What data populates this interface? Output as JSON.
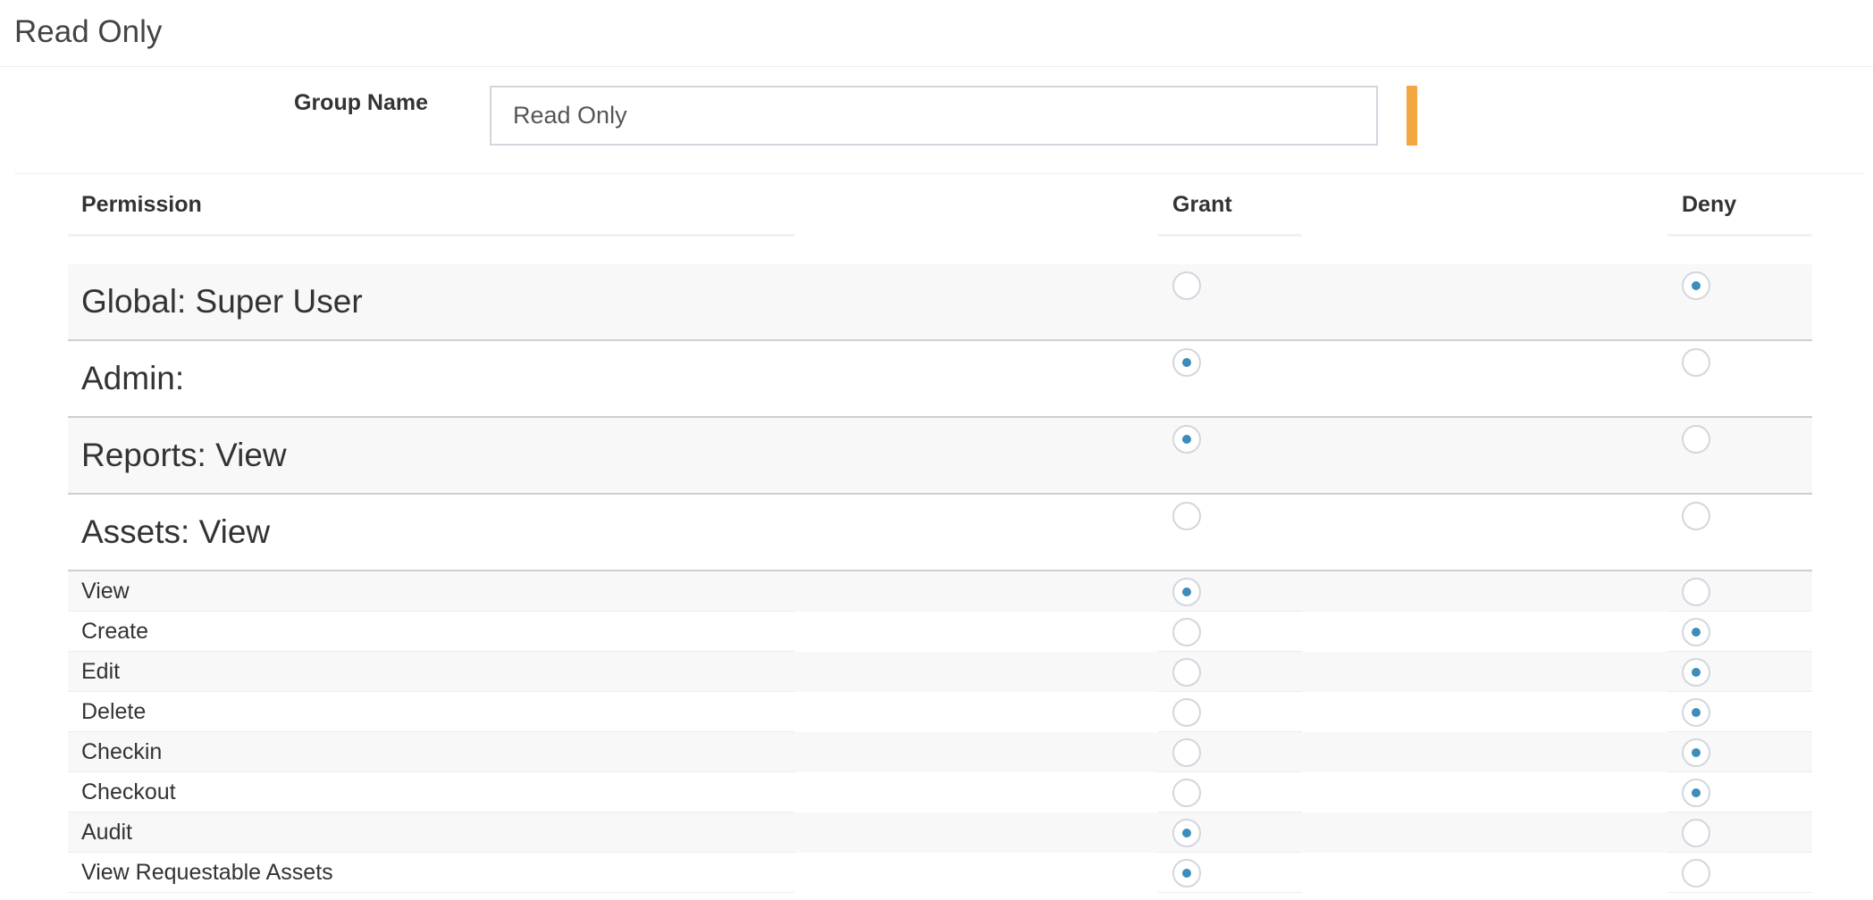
{
  "page": {
    "title": "Read Only"
  },
  "form": {
    "group_name_label": "Group Name",
    "group_name_value": "Read Only",
    "required_indicator_color": "#f4a640"
  },
  "table": {
    "columns": {
      "permission": "Permission",
      "grant": "Grant",
      "deny": "Deny"
    },
    "rows": [
      {
        "label": "Global: Super User",
        "kind": "section",
        "value": "deny"
      },
      {
        "label": "Admin:",
        "kind": "section",
        "value": "grant"
      },
      {
        "label": "Reports: View",
        "kind": "section",
        "value": "grant"
      },
      {
        "label": "Assets: View",
        "kind": "section",
        "value": "none"
      },
      {
        "label": "View",
        "kind": "item",
        "value": "grant"
      },
      {
        "label": "Create",
        "kind": "item",
        "value": "deny"
      },
      {
        "label": "Edit",
        "kind": "item",
        "value": "deny"
      },
      {
        "label": "Delete",
        "kind": "item",
        "value": "deny"
      },
      {
        "label": "Checkin",
        "kind": "item",
        "value": "deny"
      },
      {
        "label": "Checkout",
        "kind": "item",
        "value": "deny"
      },
      {
        "label": "Audit",
        "kind": "item",
        "value": "grant"
      },
      {
        "label": "View Requestable Assets",
        "kind": "item",
        "value": "grant"
      }
    ]
  },
  "colors": {
    "radio_selected": "#3c8dbc",
    "radio_border": "#d2d6de",
    "row_shade": "#f8f8f8"
  }
}
